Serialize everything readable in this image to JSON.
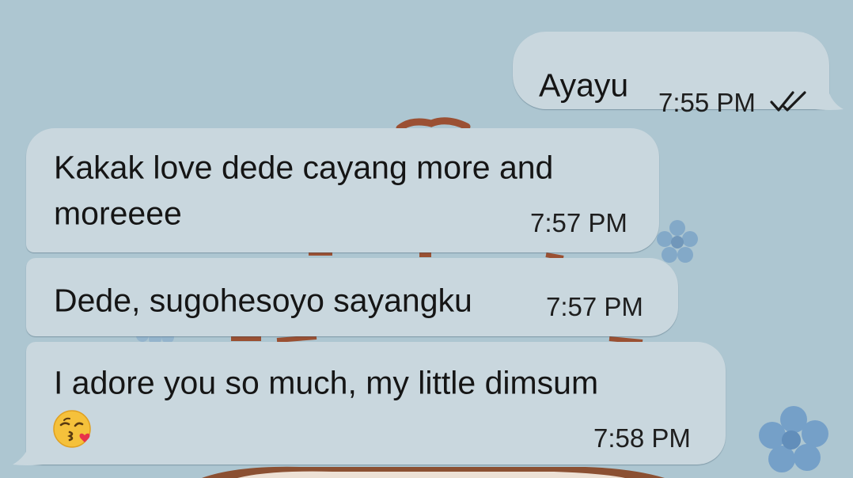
{
  "colors": {
    "wallpaper": "#adc6d1",
    "bubble": "#c9d7de",
    "text": "#151515"
  },
  "messages": [
    {
      "direction": "outgoing",
      "text": "Ayayu",
      "time": "7:55 PM",
      "status_icon": "double-check-icon"
    },
    {
      "direction": "incoming",
      "lines": [
        "Kakak love dede cayang more and",
        "moreeee"
      ],
      "time": "7:57 PM"
    },
    {
      "direction": "incoming",
      "text": "Dede, sugohesoyo sayangku",
      "time": "7:57 PM"
    },
    {
      "direction": "incoming",
      "lines": [
        "I adore you so much, my little dimsum"
      ],
      "emoji": "face-blowing-a-kiss-emoji",
      "time": "7:58 PM"
    }
  ]
}
